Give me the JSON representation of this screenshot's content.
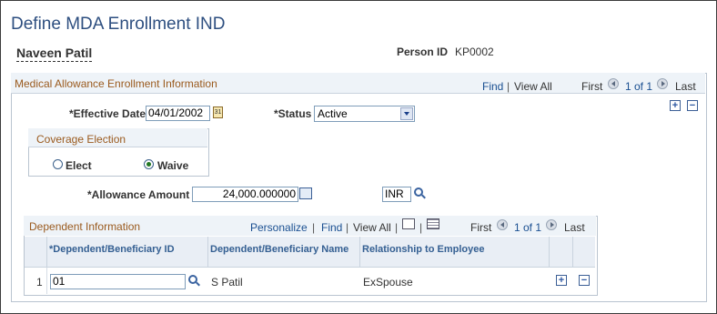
{
  "page": {
    "title": "Define MDA Enrollment IND"
  },
  "person": {
    "name": "Naveen Patil",
    "id_label": "Person ID",
    "id_value": "KP0002"
  },
  "enrollment": {
    "header": "Medical Allowance Enrollment Information",
    "nav": {
      "find": "Find",
      "view_all": "View All",
      "first": "First",
      "count": "1 of 1",
      "last": "Last"
    },
    "effective_date_label": "*Effective Date",
    "effective_date_value": "04/01/2002",
    "status_label": "*Status",
    "status_value": "Active",
    "coverage": {
      "header": "Coverage Election",
      "elect_label": "Elect",
      "waive_label": "Waive",
      "selected": "Waive"
    },
    "allowance_label": "*Allowance Amount",
    "allowance_value": "24,000.000000",
    "currency_value": "INR"
  },
  "dependents": {
    "header": "Dependent Information",
    "nav": {
      "personalize": "Personalize",
      "find": "Find",
      "view_all": "View All",
      "first": "First",
      "count": "1 of 1",
      "last": "Last"
    },
    "columns": [
      "*Dependent/Beneficiary ID",
      "Dependent/Beneficiary Name",
      "Relationship to Employee"
    ],
    "rows": [
      {
        "num": "1",
        "id": "01",
        "name": "S Patil",
        "relationship": "ExSpouse"
      }
    ]
  }
}
